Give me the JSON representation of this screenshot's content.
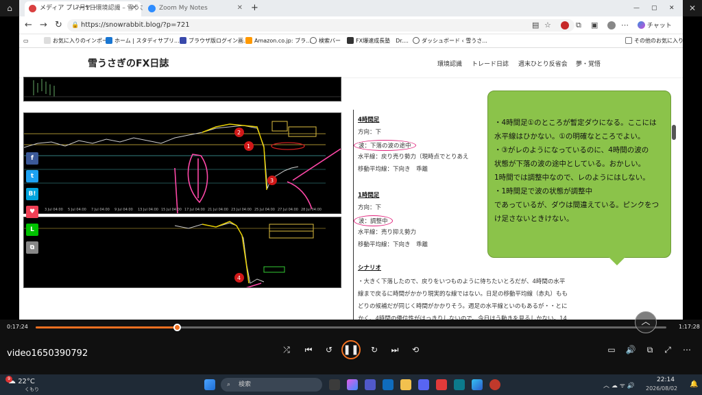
{
  "player": {
    "time_current": "0:17:24",
    "time_total": "1:17:28",
    "progress": 0.224,
    "video_title": "video1650390792"
  },
  "browser": {
    "tabs": [
      {
        "label": "メディア プレーヤー"
      },
      {
        "label": "7月1日環境認識 – 雪うさぎ"
      },
      {
        "label": "Zoom My Notes"
      }
    ],
    "url": "https://snowrabbit.blog/?p=721",
    "copilot_label": "チャット",
    "bookmarks": [
      {
        "label": "お気に入りのインポート"
      },
      {
        "label": "ホーム | スタディサプリ..."
      },
      {
        "label": "ブラウザ版ログイン画..."
      },
      {
        "label": "Amazon.co.jp: ブラ..."
      },
      {
        "label": "検索バー"
      },
      {
        "label": "FX爆速成長塾　Dr...."
      },
      {
        "label": "ダッシュボード ‹ 雪うさ..."
      },
      {
        "label": "その他のお気に入り"
      }
    ]
  },
  "site": {
    "title": "雪うさぎのFX日誌",
    "nav": [
      "環境認識",
      "トレード日誌",
      "週末ひとり反省会",
      "夢・覚悟"
    ]
  },
  "post": {
    "h4": {
      "title": "4時間足",
      "dir": "方向：下",
      "wave": "波：下落の波の途中",
      "hz": "水平線：戻り売り勢力（現時点でとりあえ",
      "ma": "移動平均線：下向き　乖離"
    },
    "h1": {
      "title": "1時間足",
      "dir": "方向：下",
      "wave": "波：調整中",
      "hz": "水平線：売り抑え勢力",
      "ma": "移動平均線：下向き　乖離"
    },
    "scenario": {
      "title": "シナリオ",
      "lines": [
        "・大きく下落したので、戻りをいつものように待ちたいとろだが、4時間の水平",
        "線まで戻るに時間がかかり現実的な線ではない。日足の移動平均線（赤丸）もも",
        "どりの候補だが同じく時間がかかりそう。週足の水平線といのもあるが・・とに",
        "かく、4時間の優位性がはっきりしないので、今日はう動きを見るしかない。14",
        "時18時22時当たり要確認。"
      ]
    },
    "note_lines": [
      "・4時間足①のところが暫定ダウになる。ここには",
      "水平線はひかない。①の明確なところでよい。",
      "・③がレのようになっているのに、4時間の波の",
      "状態が下落の波の途中としている。おかしい。",
      "1時間では調整中なので、レのようにはしない。",
      "・1時間足で波の状態が調整中",
      "であっているが、ダウは間違えている。ピンクをつ",
      "け足さないときけない。"
    ],
    "markers": [
      "1",
      "2",
      "3",
      "4"
    ],
    "share": [
      "B!"
    ]
  },
  "chart_axis": {
    "top_dates": [
      "3 Jul 04:00",
      "5 Jul 04:00",
      "7 Jul 04:00",
      "9 Jul 04:00",
      "13 Jul 04:00",
      "15 Jul 04:00",
      "17 Jul 04:00",
      "21 Jul 04:00",
      "23 Jul 04:00",
      "25 Jul 04:00",
      "27 Jul 04:00",
      "28 Jul 04:00"
    ]
  },
  "taskbar": {
    "weather_temp": "22°C",
    "weather_desc": "くもり",
    "search_placeholder": "検索",
    "clock_time": "22:14",
    "clock_date": "2026/08/02",
    "notif_count": "9"
  }
}
